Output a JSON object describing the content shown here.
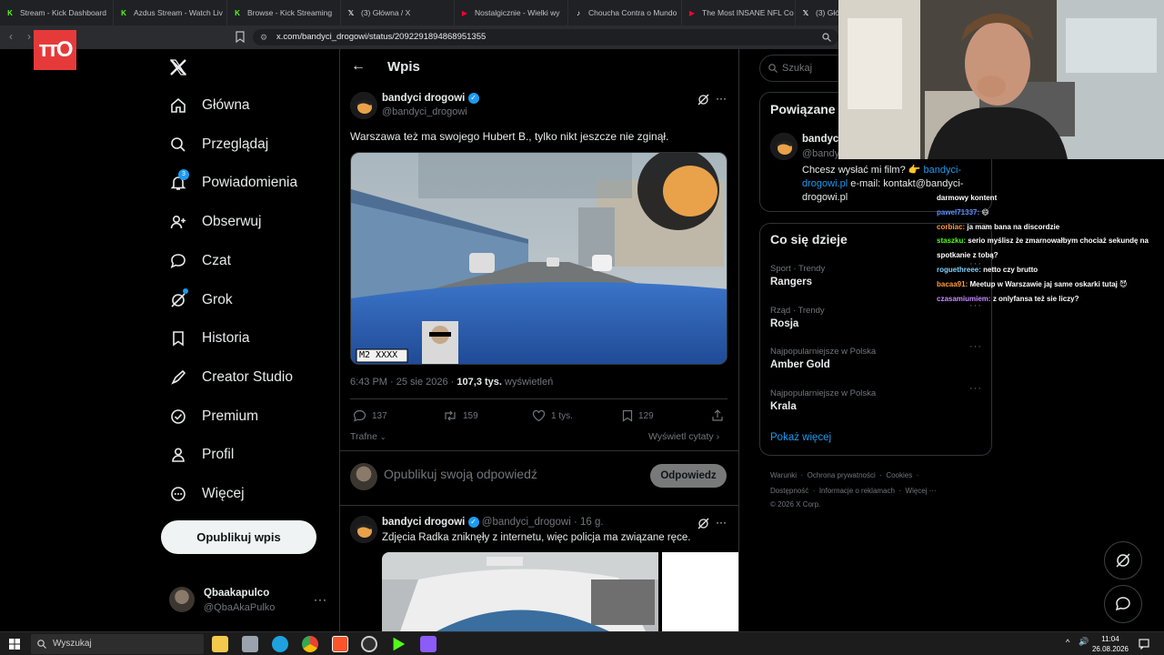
{
  "browser": {
    "tabs": [
      {
        "title": "Stream - Kick Dashboard",
        "icon": "kick-icon",
        "color": "#53fc18"
      },
      {
        "title": "Azdus Stream - Watch Liv",
        "icon": "kick-icon",
        "color": "#53fc18"
      },
      {
        "title": "Browse - Kick Streaming",
        "icon": "kick-icon",
        "color": "#53fc18"
      },
      {
        "title": "(3) Główna / X",
        "icon": "x-icon",
        "color": "#ffffff"
      },
      {
        "title": "Nostalgicznie - Wielki wy",
        "icon": "youtube-icon",
        "color": "#ff0033"
      },
      {
        "title": "Choucha Contra o Mundo",
        "icon": "tiktok-icon",
        "color": "#ffffff"
      },
      {
        "title": "The Most INSANE NFL Co",
        "icon": "youtube-icon",
        "color": "#ff0033"
      },
      {
        "title": "(3) Głów",
        "icon": "x-icon",
        "color": "#ffffff"
      }
    ],
    "url": "x.com/bandyci_drogowi/status/2092291894868951355"
  },
  "overlay_logo": "ттО",
  "sidebar": {
    "items": [
      {
        "label": "Główna",
        "icon": "home-icon"
      },
      {
        "label": "Przeglądaj",
        "icon": "search-icon"
      },
      {
        "label": "Powiadomienia",
        "icon": "bell-icon",
        "badge": "3"
      },
      {
        "label": "Obserwuj",
        "icon": "follow-icon"
      },
      {
        "label": "Czat",
        "icon": "chat-icon"
      },
      {
        "label": "Grok",
        "icon": "grok-icon"
      },
      {
        "label": "Historia",
        "icon": "bookmark-icon"
      },
      {
        "label": "Creator Studio",
        "icon": "rocket-icon"
      },
      {
        "label": "Premium",
        "icon": "verified-icon"
      },
      {
        "label": "Profil",
        "icon": "person-icon"
      },
      {
        "label": "Więcej",
        "icon": "more-icon"
      }
    ],
    "post_button": "Opublikuj wpis",
    "account": {
      "name": "Qbaakapulco",
      "handle": "@QbaAkaPulko"
    }
  },
  "main": {
    "header_title": "Wpis",
    "tweet": {
      "author": "bandyci drogowi",
      "handle": "@bandyci_drogowi",
      "text": "Warszawa też ma swojego Hubert B., tylko nikt jeszcze nie zginął.",
      "plate": "M2 XXXX",
      "meta_time": "6:43 PM · 25 sie 2026 · ",
      "views": "107,3 tys.",
      "views_label": " wyświetleń",
      "replies": "137",
      "retweets": "159",
      "likes": "1 tys.",
      "bookmarks": "129",
      "sort_label": "Trafne",
      "quotes_link": "Wyświetl cytaty"
    },
    "reply_box": {
      "placeholder": "Opublikuj swoją odpowiedź",
      "button": "Odpowiedz"
    },
    "reply_tweet": {
      "author": "bandyci drogowi",
      "handle": "@bandyci_drogowi",
      "age": "· 16 g.",
      "text": "Zdjęcia Radka zniknęły z internetu, więc policja ma związane ręce."
    }
  },
  "right": {
    "search_placeholder": "Szukaj",
    "related": {
      "title": "Powiązane",
      "name": "bandyc",
      "handle": "@bandy",
      "bio_prefix": "Chcesz wysłać mi film? 👉 ",
      "bio_link": "bandyci-drogowi.pl",
      "bio_suffix": " e-mail: kontakt@bandyci-drogowi.pl"
    },
    "trends_title": "Co się dzieje",
    "trends": [
      {
        "category": "Sport · Trendy",
        "name": "Rangers"
      },
      {
        "category": "Rząd · Trendy",
        "name": "Rosja"
      },
      {
        "category": "Najpopularniejsze w Polska",
        "name": "Amber Gold"
      },
      {
        "category": "Najpopularniejsze w Polska",
        "name": "Krala"
      }
    ],
    "show_more": "Pokaż więcej",
    "footer_line1": [
      "Warunki",
      "Ochrona prywatności",
      "Cookies"
    ],
    "footer_line2": [
      "Dostępność",
      "Informacje o reklamach",
      "Więcej ···"
    ],
    "copyright": "© 2026 X Corp."
  },
  "stream_chat": [
    {
      "user": "",
      "text": "darmowy kontent",
      "color": "#ffffff"
    },
    {
      "user": "pawel71337:",
      "text": " 😄",
      "color": "#5b8cff"
    },
    {
      "user": "corbiac:",
      "text": " ja mam bana na discordzie",
      "color": "#ff9d3a"
    },
    {
      "user": "staszku:",
      "text": " serio myślisz że zmarnowałbym chociaż sekundę na",
      "color": "#53fc18"
    },
    {
      "user": "",
      "text": "spotkanie z tobą?",
      "color": "#ffffff"
    },
    {
      "user": "roguethreee:",
      "text": " netto czy brutto",
      "color": "#7fd4ff"
    },
    {
      "user": "bacaa91:",
      "text": " Meetup w Warszawie jaj same oskarki tutaj 😈",
      "color": "#ff9d3a"
    },
    {
      "user": "czasamiumiem:",
      "text": " z onlyfansa też sie liczy?",
      "color": "#c78cff"
    }
  ],
  "taskbar": {
    "search_label": "Wyszukaj",
    "time": "11:04",
    "date": "26.08.2026"
  }
}
